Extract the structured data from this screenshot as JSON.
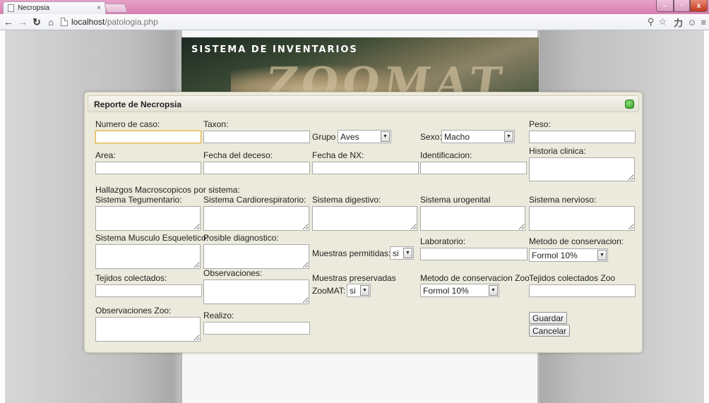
{
  "browser": {
    "tab_title": "Necropsia",
    "tab_close": "×",
    "url_host": "localhost",
    "url_path": "/patologia.php",
    "window_buttons": {
      "minimize": "–",
      "maximize": "▫",
      "close": "x"
    }
  },
  "banner": {
    "title": "SISTEMA DE INVENTARIOS",
    "logo_text": "ZOOMAT"
  },
  "dialog": {
    "title": "Reporte de Necropsia",
    "fields": {
      "numero_caso": {
        "label": "Numero de caso:",
        "value": ""
      },
      "taxon": {
        "label": "Taxon:",
        "value": ""
      },
      "grupo": {
        "label": "Grupo",
        "value": "Aves"
      },
      "sexo": {
        "label": "Sexo:",
        "value": "Macho"
      },
      "peso": {
        "label": "Peso:",
        "value": ""
      },
      "area": {
        "label": "Area:",
        "value": ""
      },
      "fecha_deceso": {
        "label": "Fecha del deceso:",
        "value": ""
      },
      "fecha_nx": {
        "label": "Fecha de NX:",
        "value": ""
      },
      "identificacion": {
        "label": "Identificacion:",
        "value": ""
      },
      "historia_clinica": {
        "label": "Historia clinica:",
        "value": ""
      },
      "hallazgos": {
        "label": "Hallazgos Macroscopicos por sistema:"
      },
      "sistema_tegumentario": {
        "label": "Sistema Tegumentario:",
        "value": ""
      },
      "sistema_cardiorespiratorio": {
        "label": "Sistema Cardiorespiratorio:",
        "value": ""
      },
      "sistema_digestivo": {
        "label": "Sistema digestivo:",
        "value": ""
      },
      "sistema_urogenital": {
        "label": "Sistema urogenital",
        "value": ""
      },
      "sistema_nervioso": {
        "label": "Sistema nervioso:",
        "value": ""
      },
      "sistema_musculo": {
        "label": "Sistema Musculo Esqueletico:",
        "value": ""
      },
      "posible_diagnostico": {
        "label": "Posible diagnostico:",
        "value": ""
      },
      "muestras_permitidas": {
        "label": "Muestras permitidas:",
        "value": "si"
      },
      "laboratorio": {
        "label": "Laboratorio:",
        "value": ""
      },
      "metodo_conservacion": {
        "label": "Metodo de conservacion:",
        "value": "Formol 10%"
      },
      "tejidos_colectados": {
        "label": "Tejidos colectados:",
        "value": ""
      },
      "observaciones": {
        "label": "Observaciones:",
        "value": ""
      },
      "muestras_preservadas": {
        "label_line1": "Muestras preservadas",
        "label_line2": "ZooMAT:",
        "value": "si"
      },
      "metodo_conservacion_zoo": {
        "label": "Metodo de conservacion Zoo",
        "value": "Formol 10%"
      },
      "tejidos_colectados_zoo": {
        "label": "Tejidos colectados Zoo",
        "value": ""
      },
      "observaciones_zoo": {
        "label": "Observaciones Zoo:",
        "value": ""
      },
      "realizo": {
        "label": "Realizo:",
        "value": ""
      }
    },
    "buttons": {
      "guardar": "Guardar",
      "cancelar": "Cancelar"
    }
  },
  "icons": {
    "back": "back-arrow-icon",
    "forward": "forward-arrow-icon",
    "reload": "reload-icon",
    "home": "home-icon",
    "page": "page-icon",
    "zoom": "zoom-icon",
    "star": "bookmark-star-icon",
    "ext1": "translate-extension-icon",
    "ext2": "extension-icon",
    "menu": "menu-icon"
  },
  "colors": {
    "titlebar": "#d87fb1",
    "dialog_bg": "#eceadc",
    "close_dot": "#2d9a1f",
    "focus_border": "#e0b040"
  }
}
